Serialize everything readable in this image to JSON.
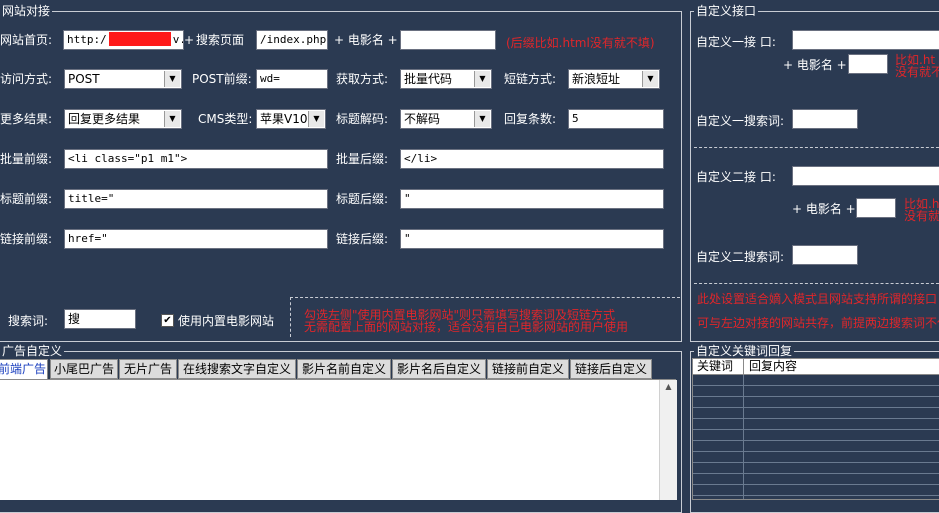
{
  "site_group": {
    "legend": "网站对接",
    "homepage_label": "网站首页:",
    "homepage_value": "http:/",
    "homepage_tail": "v.",
    "search_page_prefix": "+",
    "search_page_label": "搜索页面",
    "search_page_value": "/index.php?",
    "movie_name_label": "+ 电影名 +",
    "movie_name_value": "",
    "suffix_note": "(后缀比如.html没有就不填)",
    "access_label": "访问方式:",
    "access_value": "POST",
    "post_prefix_label": "POST前缀:",
    "post_prefix_value": "wd=",
    "fetch_label": "获取方式:",
    "fetch_value": "批量代码",
    "shortlink_label": "短链方式:",
    "shortlink_value": "新浪短址",
    "more_label": "更多结果:",
    "more_value": "回复更多结果",
    "cms_label": "CMS类型:",
    "cms_value": "苹果V10",
    "title_decode_label": "标题解码:",
    "title_decode_value": "不解码",
    "reply_count_label": "回复条数:",
    "reply_count_value": "5",
    "batch_prefix_label": "批量前缀:",
    "batch_prefix_value": "<li class=\"p1 m1\">",
    "batch_suffix_label": "批量后缀:",
    "batch_suffix_value": "</li>",
    "title_prefix_label": "标题前缀:",
    "title_prefix_value": "title=\"",
    "title_suffix_label": "标题后缀:",
    "title_suffix_value": "\"",
    "link_prefix_label": "链接前缀:",
    "link_prefix_value": "href=\"",
    "link_suffix_label": "链接后缀:",
    "link_suffix_value": "\"",
    "search_word_label": "搜索词:",
    "search_word_value": "搜",
    "builtin_label": "使用内置电影网站",
    "builtin_checked": "✔",
    "builtin_note_1": "勾选左侧\"使用内置电影网站\"则只需填写搜索词及短链方式",
    "builtin_note_2": "无需配置上面的网站对接，适合没有自己电影网站的用户使用"
  },
  "custom_group": {
    "legend": "自定义接口",
    "custom1_label": "自定义一接 口:",
    "custom1_value": "",
    "custom1_movie_label": "+ 电影名 +",
    "custom1_movie_value": "",
    "custom1_note_1": "比如.ht",
    "custom1_note_2": "没有就不",
    "custom1_search_label": "自定义一搜索词:",
    "custom1_search_value": "",
    "custom2_label": "自定义二接 口:",
    "custom2_value": "",
    "custom2_movie_label": "+ 电影名 +",
    "custom2_movie_value": "",
    "custom2_note_1": "比如.h",
    "custom2_note_2": "没有就",
    "custom2_search_label": "自定义二搜索词:",
    "custom2_search_value": "",
    "note_1": "此处设置适合嫡入模式且网站支持所谓的接口",
    "note_2": "可与左边对接的网站共存，前提两边搜索词不仅"
  },
  "ad_group": {
    "legend": "广告自定义",
    "tabs": [
      "前端广告",
      "小尾巴广告",
      "无片广告",
      "在线搜索文字自定义",
      "影片名前自定义",
      "影片名后自定义",
      "链接前自定义",
      "链接后自定义"
    ],
    "scroll_up": "▲"
  },
  "keyword_group": {
    "legend": "自定义关键词回复",
    "col_keyword": "关键词",
    "col_reply": "回复内容"
  },
  "colors": {
    "background": "#2b3a52",
    "note_red": "#e0262a",
    "redaction": "#ff1a1a"
  },
  "icons": {
    "dropdown": "chevron-down-icon",
    "checkbox": "check-icon"
  }
}
